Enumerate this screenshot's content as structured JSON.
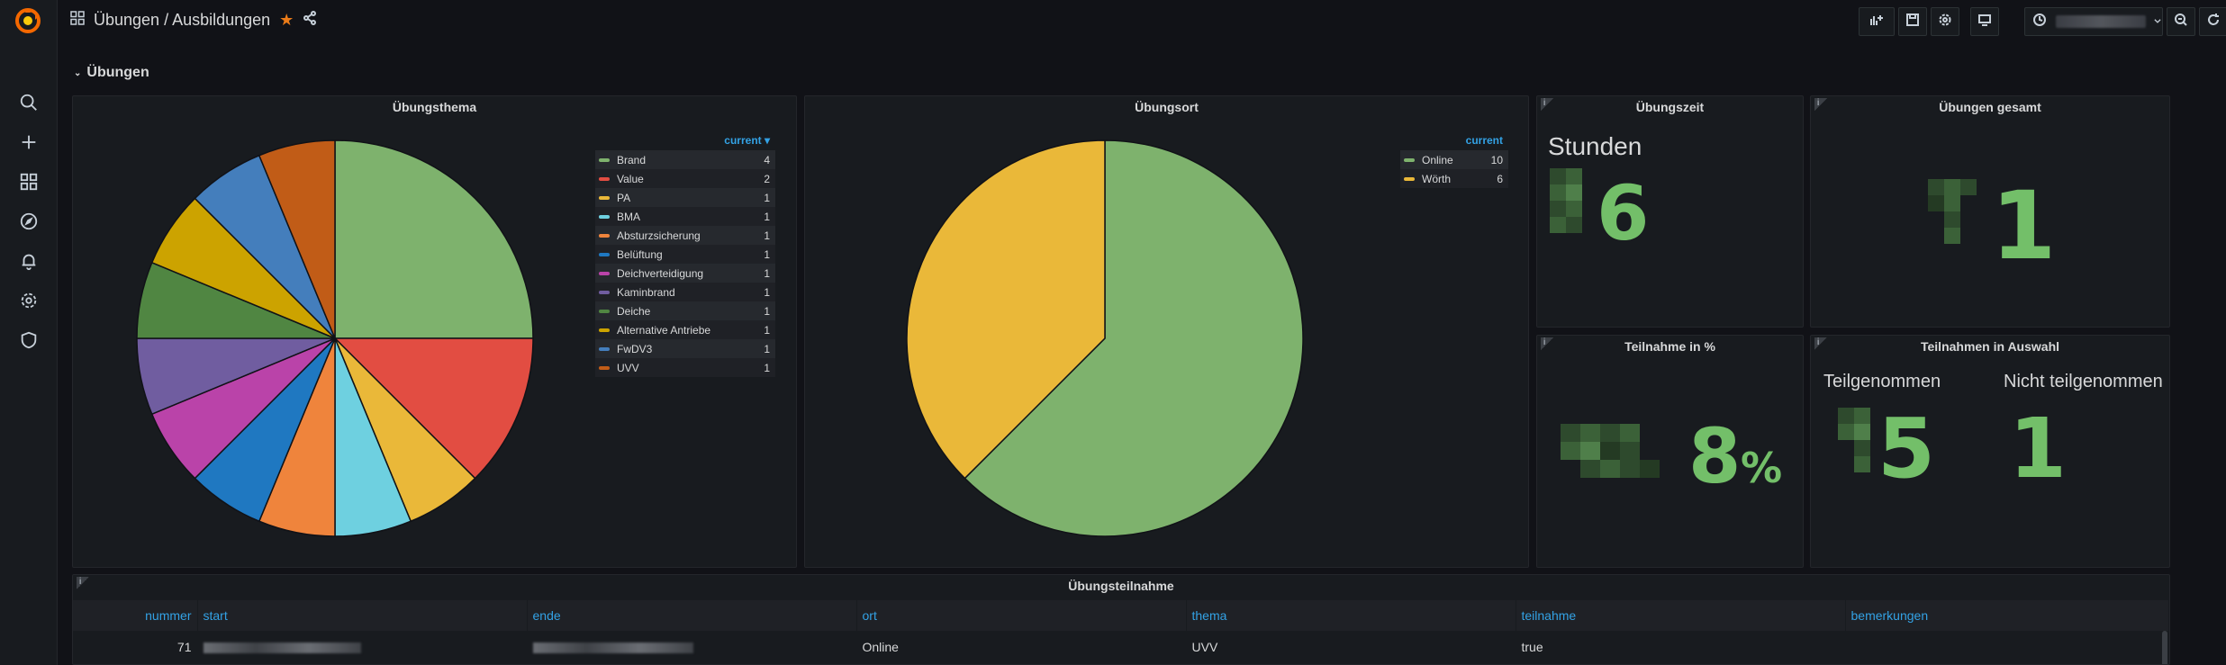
{
  "header": {
    "title": "Übungen / Ausbildungen"
  },
  "row": {
    "title": "Übungen"
  },
  "panels": {
    "uebungsthema": {
      "title": "Übungsthema",
      "legend_header": "current ▾",
      "items": [
        {
          "name": "Brand",
          "value": 4,
          "color": "#7eb26d"
        },
        {
          "name": "Value",
          "value": 2,
          "color": "#e24d42"
        },
        {
          "name": "PA",
          "value": 1,
          "color": "#eab839"
        },
        {
          "name": "BMA",
          "value": 1,
          "color": "#6ed0e0"
        },
        {
          "name": "Absturzsicherung",
          "value": 1,
          "color": "#ef843c"
        },
        {
          "name": "Belüftung",
          "value": 1,
          "color": "#1f78c1"
        },
        {
          "name": "Deichverteidigung",
          "value": 1,
          "color": "#ba43a9"
        },
        {
          "name": "Kaminbrand",
          "value": 1,
          "color": "#705da0"
        },
        {
          "name": "Deiche",
          "value": 1,
          "color": "#508642"
        },
        {
          "name": "Alternative Antriebe",
          "value": 1,
          "color": "#cca300"
        },
        {
          "name": "FwDV3",
          "value": 1,
          "color": "#447ebc"
        },
        {
          "name": "UVV",
          "value": 1,
          "color": "#c15c17"
        }
      ]
    },
    "uebungsort": {
      "title": "Übungsort",
      "legend_header": "current",
      "items": [
        {
          "name": "Online",
          "value": 10,
          "color": "#7eb26d"
        },
        {
          "name": "Wörth",
          "value": 6,
          "color": "#eab839"
        }
      ]
    },
    "uebungszeit": {
      "title": "Übungszeit",
      "label": "Stunden",
      "value": "6"
    },
    "uebungen_gesamt": {
      "title": "Übungen gesamt",
      "value": "1"
    },
    "teilnahme_prozent": {
      "title": "Teilnahme in %",
      "value": "8",
      "unit": "%"
    },
    "teilnahmen_auswahl": {
      "title": "Teilnahmen in Auswahl",
      "label_yes": "Teilgenommen",
      "value_yes": "5",
      "label_no": "Nicht teilgenommen",
      "value_no": "1"
    },
    "uebungsteilnahme": {
      "title": "Übungsteilnahme",
      "columns": [
        "nummer",
        "start",
        "ende",
        "ort",
        "thema",
        "teilnahme",
        "bemerkungen"
      ],
      "rows": [
        {
          "nummer": "71",
          "ort": "Online",
          "thema": "UVV",
          "teilnahme": "true",
          "bemerkungen": ""
        }
      ]
    }
  },
  "chart_data": [
    {
      "type": "pie",
      "title": "Übungsthema",
      "categories": [
        "Brand",
        "Value",
        "PA",
        "BMA",
        "Absturzsicherung",
        "Belüftung",
        "Deichverteidigung",
        "Kaminbrand",
        "Deiche",
        "Alternative Antriebe",
        "FwDV3",
        "UVV"
      ],
      "values": [
        4,
        2,
        1,
        1,
        1,
        1,
        1,
        1,
        1,
        1,
        1,
        1
      ],
      "legend": "right"
    },
    {
      "type": "pie",
      "title": "Übungsort",
      "categories": [
        "Online",
        "Wörth"
      ],
      "values": [
        10,
        6
      ],
      "legend": "top-right"
    }
  ],
  "icons": [
    "grafana-logo-icon",
    "search-icon",
    "plus-icon",
    "dashboards-icon",
    "explore-icon",
    "bell-icon",
    "gear-icon",
    "shield-icon",
    "grid-icon",
    "star-icon",
    "share-icon",
    "add-panel-icon",
    "save-icon",
    "settings-icon",
    "tv-icon",
    "clock-icon",
    "chevron-down-icon",
    "zoom-out-icon",
    "refresh-icon"
  ]
}
